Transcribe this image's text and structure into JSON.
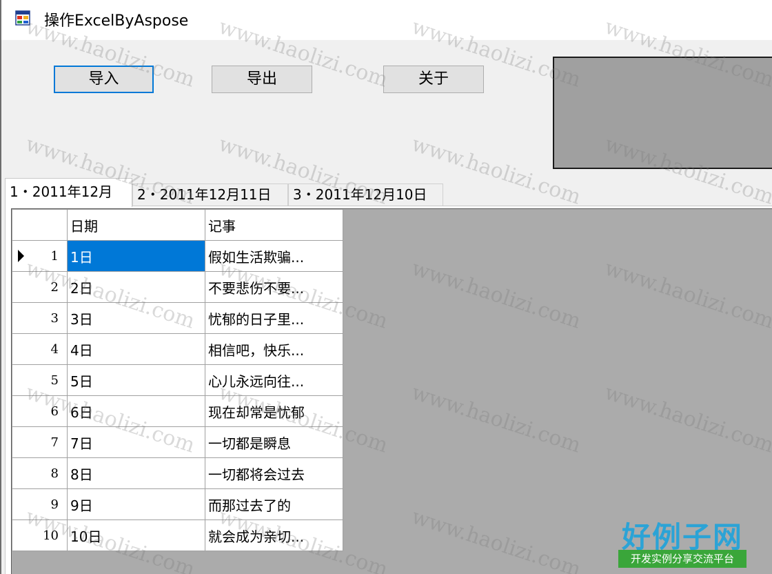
{
  "window": {
    "title": "操作ExcelByAspose",
    "icon": "windows-form-icon"
  },
  "toolbar": {
    "import_label": "导入",
    "export_label": "导出",
    "about_label": "关于"
  },
  "tabs": [
    {
      "label": "1・2011年12月"
    },
    {
      "label": "2・2011年12月11日"
    },
    {
      "label": "3・2011年12月10日"
    }
  ],
  "grid": {
    "headers": {
      "date": "日期",
      "note": "记事"
    },
    "rows": [
      {
        "num": "1",
        "date": "1日",
        "note": "假如生活欺骗..."
      },
      {
        "num": "2",
        "date": "2日",
        "note": "不要悲伤不要..."
      },
      {
        "num": "3",
        "date": "3日",
        "note": "忧郁的日子里..."
      },
      {
        "num": "4",
        "date": "4日",
        "note": "相信吧，快乐..."
      },
      {
        "num": "5",
        "date": "5日",
        "note": "心儿永远向往..."
      },
      {
        "num": "6",
        "date": "6日",
        "note": "现在却常是忧郁"
      },
      {
        "num": "7",
        "date": "7日",
        "note": "一切都是瞬息"
      },
      {
        "num": "8",
        "date": "8日",
        "note": "一切都将会过去"
      },
      {
        "num": "9",
        "date": "9日",
        "note": "而那过去了的"
      },
      {
        "num": "10",
        "date": "10日",
        "note": "就会成为亲切..."
      }
    ]
  },
  "watermark": {
    "text": "www.haolizi.com"
  },
  "logo": {
    "main": "好例子网",
    "sub": "开发实例分享交流平台"
  },
  "colors": {
    "selection": "#0078d7",
    "focus_border": "#0078d7",
    "grid_bg": "#ababab"
  }
}
